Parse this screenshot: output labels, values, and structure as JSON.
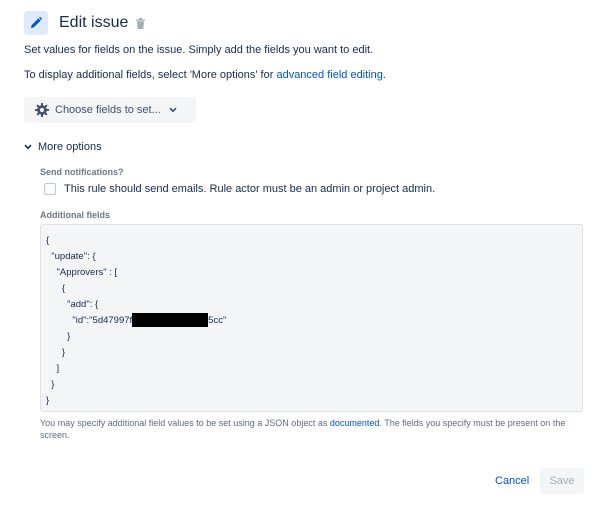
{
  "header": {
    "title": "Edit issue",
    "edit_icon": "pencil-icon",
    "delete_icon": "trash-icon",
    "accent_bg": "#deebff",
    "accent": "#0052cc"
  },
  "description": {
    "line1": "Set values for fields on the issue. Simply add the fields you want to edit.",
    "line2_prefix": "To display additional fields, select 'More options' for ",
    "line2_link": "advanced field editing",
    "line2_suffix": "."
  },
  "choose_fields": {
    "label": "Choose fields to set...",
    "icon": "gear-icon",
    "chevron": "chevron-down-icon"
  },
  "more_options": {
    "label": "More options",
    "chevron": "chevron-down-icon",
    "send_notifications_label": "Send notifications?",
    "checkbox_label": "This rule should send emails. Rule actor must be an admin or project admin.",
    "checkbox_checked": false,
    "additional_fields_label": "Additional fields",
    "json_lines": {
      "l1": "{",
      "l2": "  \"update\": {",
      "l3": "    \"Approvers\" : [",
      "l4": "      {",
      "l5": "        \"add\": {",
      "l6_prefix": "          \"id\":\"5d47997f",
      "l6_suffix": "5cc\"",
      "l7": "        }",
      "l8": "      }",
      "l9": "    ]",
      "l10": "  }",
      "l11": "}"
    },
    "help_prefix": "You may specify additional field values to be set using a JSON object as ",
    "help_link": "documented",
    "help_suffix": ". The fields you specify must be present on the screen."
  },
  "footer": {
    "cancel_label": "Cancel",
    "save_label": "Save",
    "save_disabled": true
  }
}
